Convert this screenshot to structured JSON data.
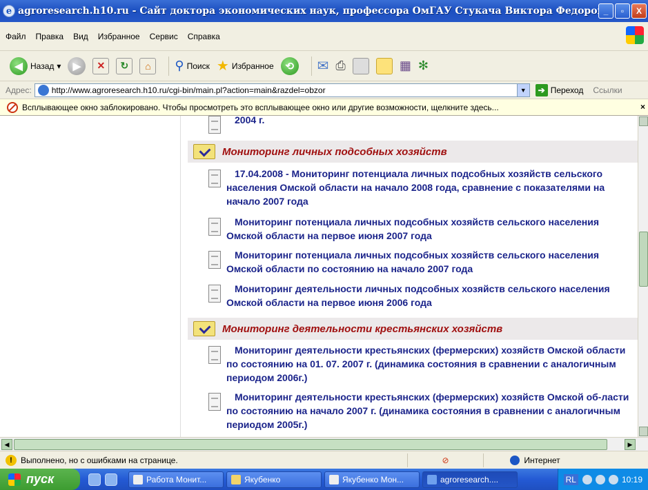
{
  "window": {
    "title": "agroresearch.h10.ru - Сайт доктора экономических наук, профессора ОмГАУ Стукача Виктора Федоров - Mi...",
    "minimize": "_",
    "maximize": "▫",
    "close": "X"
  },
  "menu": [
    "Файл",
    "Правка",
    "Вид",
    "Избранное",
    "Сервис",
    "Справка"
  ],
  "toolbar": {
    "back": "Назад",
    "back_arrow": "▾",
    "search": "Поиск",
    "favorites": "Избранное"
  },
  "address": {
    "label": "Адрес:",
    "url": "http://www.agroresearch.h10.ru/cgi-bin/main.pl?action=main&razdel=obzor",
    "go": "Переход",
    "links": "Ссылки"
  },
  "infobar": {
    "text": "Всплывающее окно заблокировано. Чтобы просмотреть это всплывающее окно или другие возможности, щелкните здесь...",
    "close": "×"
  },
  "content": {
    "top_fragment": "2004 г.",
    "sections": [
      {
        "title": "Мониторинг личных подсобных хозяйств",
        "items": [
          "17.04.2008 - Мониторинг потенциала личных подсобных хозяйств сельского населения Омской области на начало 2008 года, сравнение с показателями на начало 2007 года",
          "Мониторинг потенциала личных подсобных хозяйств сельского населения Омской области на первое июня 2007 года",
          "Мониторинг потенциала личных подсобных хозяйств сельского населения Омской области по состоянию на начало 2007 года",
          "Мониторинг деятельности личных подсобных хозяйств сельского населения Омской области на первое июня 2006 года"
        ]
      },
      {
        "title": "Мониторинг деятельности крестьянских хозяйств",
        "items": [
          "Мониторинг деятельности крестьянских (фермерских) хозяйств Омской области по состоянию на 01. 07. 2007 г. (динамика состояния в сравнении с аналогичным периодом 2006г.)",
          "Мониторинг деятельности крестьянских (фермерских) хозяйств Омской об-ласти по состоянию на начало 2007 г. (динамика состояния в сравнении с аналогичным периодом 2005г.)"
        ]
      }
    ]
  },
  "status": {
    "text": "Выполнено, но с ошибками на странице.",
    "zone": "Интернет"
  },
  "taskbar": {
    "start": "пуск",
    "buttons": [
      "Работа Монит...",
      "Якубенко",
      "Якубенко Мон...",
      "agroresearch...."
    ],
    "lang": "RL",
    "clock": "10:19"
  },
  "colors": {
    "section_title": "#a01010",
    "link": "#1a238a",
    "section_bg": "#ece9ea"
  }
}
